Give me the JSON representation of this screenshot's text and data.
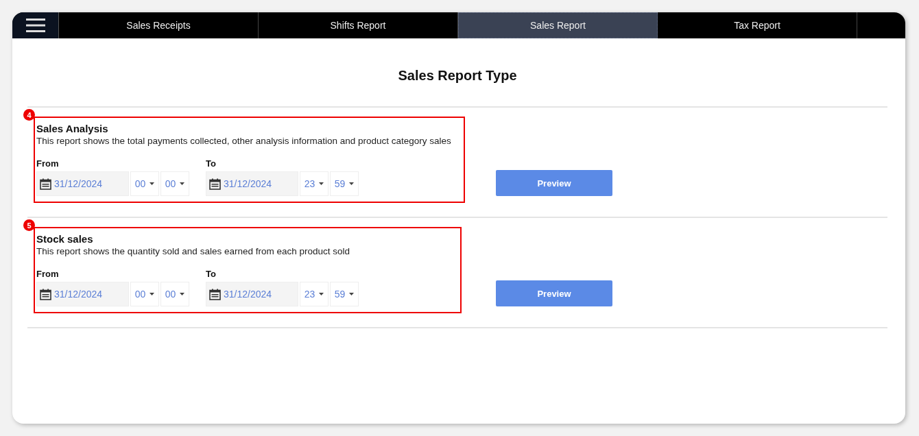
{
  "tabs": [
    {
      "label": "Sales Receipts",
      "selected": false
    },
    {
      "label": "Shifts Report",
      "selected": false
    },
    {
      "label": "Sales Report",
      "selected": true
    },
    {
      "label": "Tax Report",
      "selected": false
    }
  ],
  "page_title": "Sales Report Type",
  "sections": [
    {
      "marker": "4",
      "title": "Sales Analysis",
      "description": "This report shows the total payments collected, other analysis information and product category sales",
      "from": {
        "label": "From",
        "date": "31/12/2024",
        "hour": "00",
        "minute": "00"
      },
      "to": {
        "label": "To",
        "date": "31/12/2024",
        "hour": "23",
        "minute": "59"
      },
      "button": "Preview"
    },
    {
      "marker": "5",
      "title": "Stock sales",
      "description": "This report shows the quantity sold and sales earned from each product sold",
      "from": {
        "label": "From",
        "date": "31/12/2024",
        "hour": "00",
        "minute": "00"
      },
      "to": {
        "label": "To",
        "date": "31/12/2024",
        "hour": "23",
        "minute": "59"
      },
      "button": "Preview"
    }
  ]
}
